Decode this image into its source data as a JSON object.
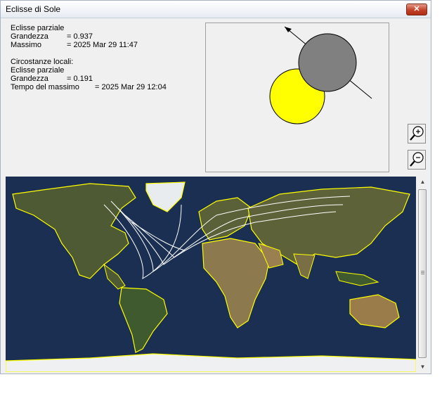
{
  "window": {
    "title": "Eclisse di Sole",
    "close_label": "✕"
  },
  "global": {
    "type": "Eclisse parziale",
    "magnitude_label": "Grandezza",
    "magnitude_value": "= 0.937",
    "maximum_label": "Massimo",
    "maximum_value": "= 2025 Mar 29  11:47"
  },
  "local": {
    "heading": "Circostanze locali:",
    "type": "Eclisse parziale",
    "magnitude_label": "Grandezza",
    "magnitude_value": "= 0.191",
    "max_time_label": "Tempo del massimo",
    "max_time_value": "= 2025 Mar 29  12:04"
  },
  "preview": {
    "sun_color": "#ffff00",
    "moon_color": "#808080"
  },
  "zoom": {
    "in_icon": "zoom-in-icon",
    "out_icon": "zoom-out-icon"
  },
  "map": {
    "ocean_color": "#1a2f52",
    "border_color": "#ffff00",
    "path_color": "#ffffff"
  },
  "scrollbar": {
    "up_arrow": "▲",
    "down_arrow": "▼"
  }
}
